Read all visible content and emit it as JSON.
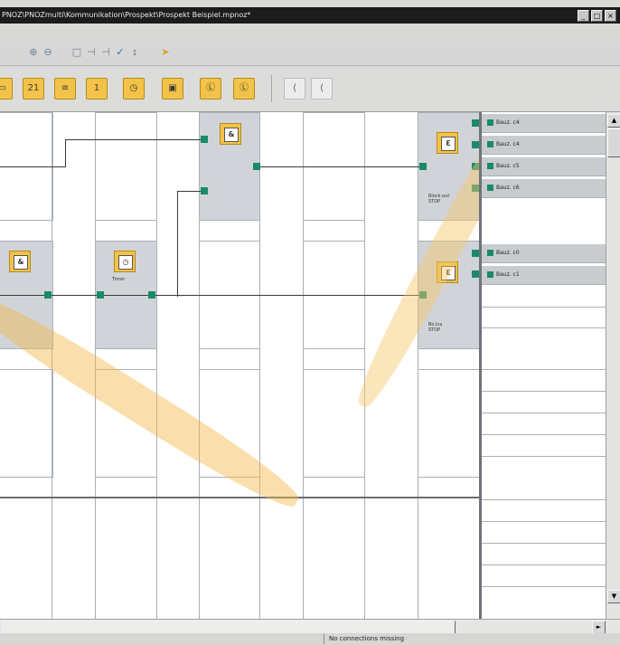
{
  "window": {
    "title": "PNOZ\\PNOZmulti\\Kommunikation\\Prospekt\\Prospekt Beispiel.mpnoz*",
    "buttons": [
      "_",
      "□",
      "×"
    ]
  },
  "toolbar_secondary": {
    "icons": [
      "zoom-in-icon",
      "zoom-out-icon",
      "select-icon",
      "connect-icon",
      "connect-icon",
      "check-icon",
      "info-icon",
      "arrow-icon"
    ]
  },
  "toolbar_elements": [
    {
      "icon": "element-icon",
      "glyph": "▭"
    },
    {
      "icon": "counter-icon",
      "glyph": "21"
    },
    {
      "icon": "output-icon",
      "glyph": "≡"
    },
    {
      "icon": "number-icon",
      "glyph": "1"
    },
    {
      "icon": "clock-icon",
      "glyph": "◷"
    },
    {
      "icon": "display-icon",
      "glyph": "▣"
    },
    {
      "icon": "timer-icon",
      "glyph": "Ⓛ"
    },
    {
      "icon": "timer2-icon",
      "glyph": "Ⓛ"
    },
    {
      "icon": "in-icon",
      "glyph": "⟨"
    },
    {
      "icon": "out-icon",
      "glyph": "⟨"
    }
  ],
  "canvas": {
    "blocks": [
      {
        "name": "and-block-top",
        "glyph": "&",
        "label": ""
      },
      {
        "name": "and-block-left",
        "glyph": "&",
        "label": ""
      },
      {
        "name": "timer-block",
        "glyph": "◷",
        "label": "Timer"
      },
      {
        "name": "output-block-top",
        "glyph": "Ɛ",
        "label": "Block.out\nSTOP"
      },
      {
        "name": "output-block-bottom",
        "glyph": "Ɛ",
        "label": "Bo.Ica\nSTOP"
      }
    ]
  },
  "io_panel": {
    "rows": [
      "Bauz. c4",
      "Bauz. c4",
      "Bauz. c5",
      "Bauz. c6",
      "Bauz. c0",
      "Bauz. c1"
    ]
  },
  "status": {
    "text": "No connections missing"
  },
  "colors": {
    "accent": "#f2c348",
    "port": "#1a8a6a",
    "title_bg": "#1c1c1c"
  }
}
